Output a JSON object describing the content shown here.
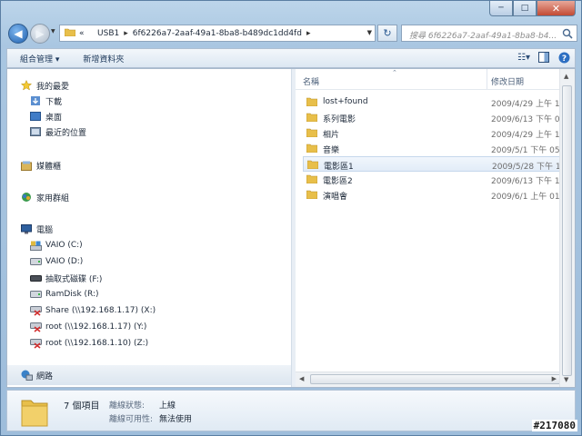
{
  "window": {
    "caption_buttons": {
      "minimize": "─",
      "maximize": "□",
      "close": "✕"
    }
  },
  "nav": {
    "back_icon": "back-arrow-icon",
    "forward_icon": "forward-arrow-icon",
    "address": {
      "prefix": "«",
      "crumbs": [
        "USB1",
        "6f6226a7-2aaf-49a1-8ba8-b489dc1dd4fd"
      ],
      "sep": "▸"
    },
    "search_placeholder": "搜尋 6f6226a7-2aaf-49a1-8ba8-b4..."
  },
  "toolbar": {
    "organize_label": "組合管理 ▾",
    "new_folder_label": "新增資料夾"
  },
  "sidebar": {
    "favorites": {
      "label": "我的最愛",
      "items": [
        "下載",
        "桌面",
        "最近的位置"
      ]
    },
    "libraries": {
      "label": "媒體櫃"
    },
    "homegroup": {
      "label": "家用群組"
    },
    "computer": {
      "label": "電腦",
      "items": [
        "VAIO (C:)",
        "VAIO (D:)",
        "抽取式磁碟 (F:)",
        "RamDisk (R:)",
        "Share (\\\\192.168.1.17) (X:)",
        "root (\\\\192.168.1.17) (Y:)",
        "root (\\\\192.168.1.10) (Z:)"
      ]
    },
    "network": {
      "label": "網路"
    }
  },
  "files": {
    "columns": {
      "name": "名稱",
      "date": "修改日期"
    },
    "rows": [
      {
        "name": "lost+found",
        "date": "2009/4/29 上午 1..."
      },
      {
        "name": "系列電影",
        "date": "2009/6/13 下午 0..."
      },
      {
        "name": "相片",
        "date": "2009/4/29 上午 1..."
      },
      {
        "name": "音樂",
        "date": "2009/5/1 下午 05..."
      },
      {
        "name": "電影區1",
        "date": "2009/5/28 下午 1..."
      },
      {
        "name": "電影區2",
        "date": "2009/6/13 下午 1..."
      },
      {
        "name": "演唱會",
        "date": "2009/6/1 上午 01..."
      }
    ],
    "selected_index": 4
  },
  "details": {
    "count": "7 個項目",
    "state_label": "離線狀態:",
    "state_value": "上線",
    "avail_label": "離線可用性:",
    "avail_value": "無法使用"
  },
  "watermark": "#217080",
  "colors": {
    "folder": "#e8bf4a",
    "accent": "#1f5fad"
  }
}
